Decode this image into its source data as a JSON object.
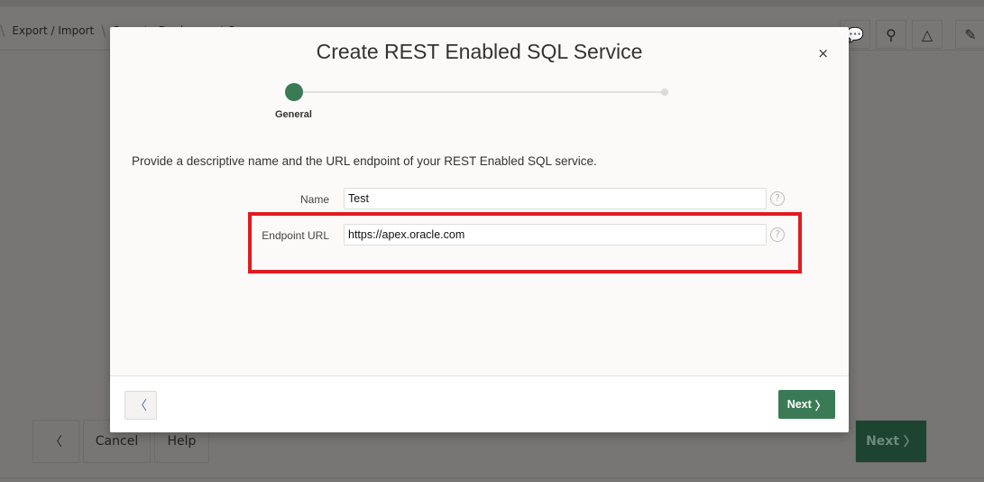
{
  "breadcrumb": {
    "items": [
      "Export / Import",
      "Remote Deployment S"
    ]
  },
  "toolbar": {
    "icons": [
      "comment-add-icon",
      "flashlight-icon",
      "shapes-icon",
      "edit-icon"
    ]
  },
  "page_footer": {
    "prev_icon": "chevron-left-icon",
    "cancel_label": "Cancel",
    "help_label": "Help",
    "next_label": "Next"
  },
  "modal": {
    "title": "Create REST Enabled SQL Service",
    "close_label": "×",
    "wizard": {
      "steps": [
        {
          "label": "General",
          "active": true
        },
        {
          "label": "",
          "active": false
        }
      ]
    },
    "description": "Provide a descriptive name and the URL endpoint of your REST Enabled SQL service.",
    "fields": [
      {
        "label": "Name",
        "value": "Test",
        "help": "?"
      },
      {
        "label": "Endpoint URL",
        "value": "https://apex.oracle.com",
        "help": "?"
      }
    ],
    "next_label": "Next",
    "accent_color": "#3a7b56",
    "highlight_color": "#e01b22"
  }
}
